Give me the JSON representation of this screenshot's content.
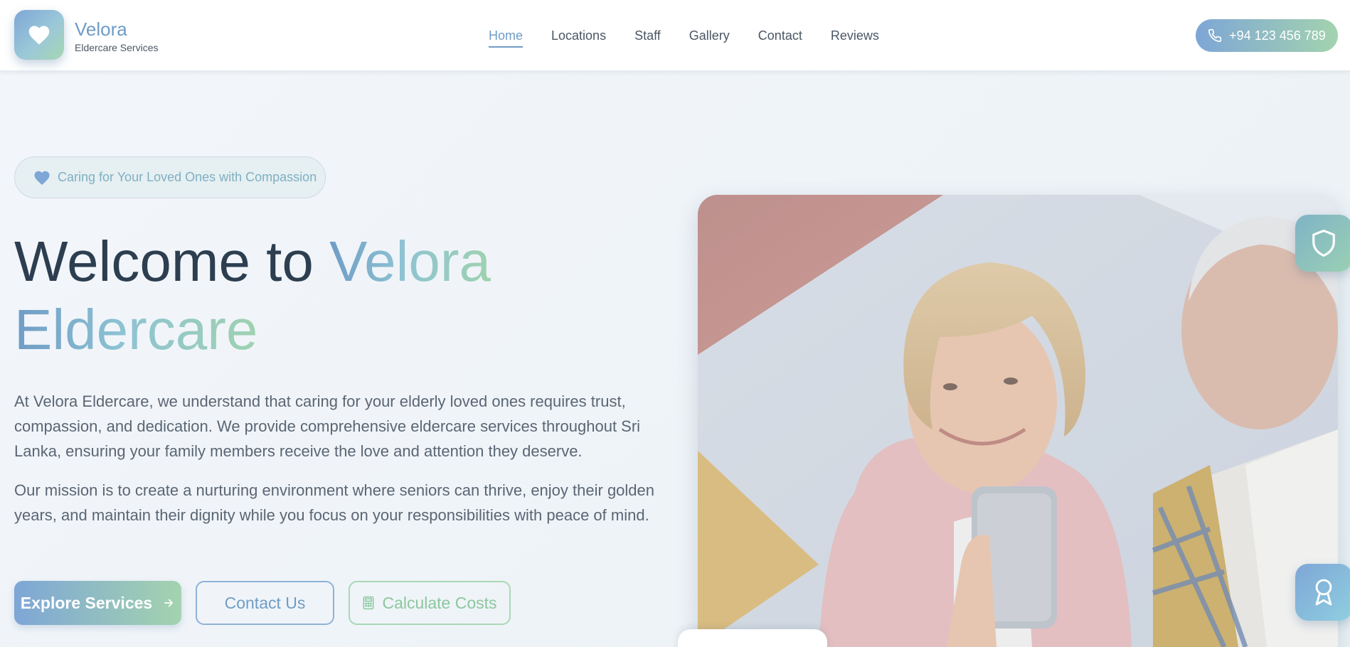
{
  "brand": {
    "name": "Velora",
    "subtitle": "Eldercare Services"
  },
  "nav": {
    "items": [
      {
        "label": "Home",
        "active": true
      },
      {
        "label": "Locations",
        "active": false
      },
      {
        "label": "Staff",
        "active": false
      },
      {
        "label": "Gallery",
        "active": false
      },
      {
        "label": "Contact",
        "active": false
      },
      {
        "label": "Reviews",
        "active": false
      }
    ]
  },
  "header": {
    "phone": "+94 123 456 789"
  },
  "hero": {
    "tagline": "Caring for Your Loved Ones with Compassion",
    "title_plain": "Welcome to ",
    "title_highlight_1": "Velora",
    "title_highlight_2": "Eldercare",
    "paragraph_1": "At Velora Eldercare, we understand that caring for your elderly loved ones requires trust, compassion, and dedication. We provide comprehensive eldercare services throughout Sri Lanka, ensuring your family members receive the love and attention they deserve.",
    "paragraph_2": "Our mission is to create a nurturing environment where seniors can thrive, enjoy their golden years, and maintain their dignity while you focus on your responsibilities with peace of mind.",
    "buttons": {
      "explore": "Explore Services",
      "contact": "Contact Us",
      "calculate": "Calculate Costs"
    }
  },
  "icons": {
    "logo": "heart-icon",
    "phone": "phone-icon",
    "tagline": "heart-icon",
    "explore": "arrow-right-icon",
    "calculate": "calculator-icon",
    "badge_top": "shield-icon",
    "badge_bottom": "award-icon"
  },
  "colors": {
    "accent_blue": "#6f9cc6",
    "accent_green": "#a3d3ae",
    "text_dark": "#2c3e50",
    "text_body": "#5a6675"
  }
}
